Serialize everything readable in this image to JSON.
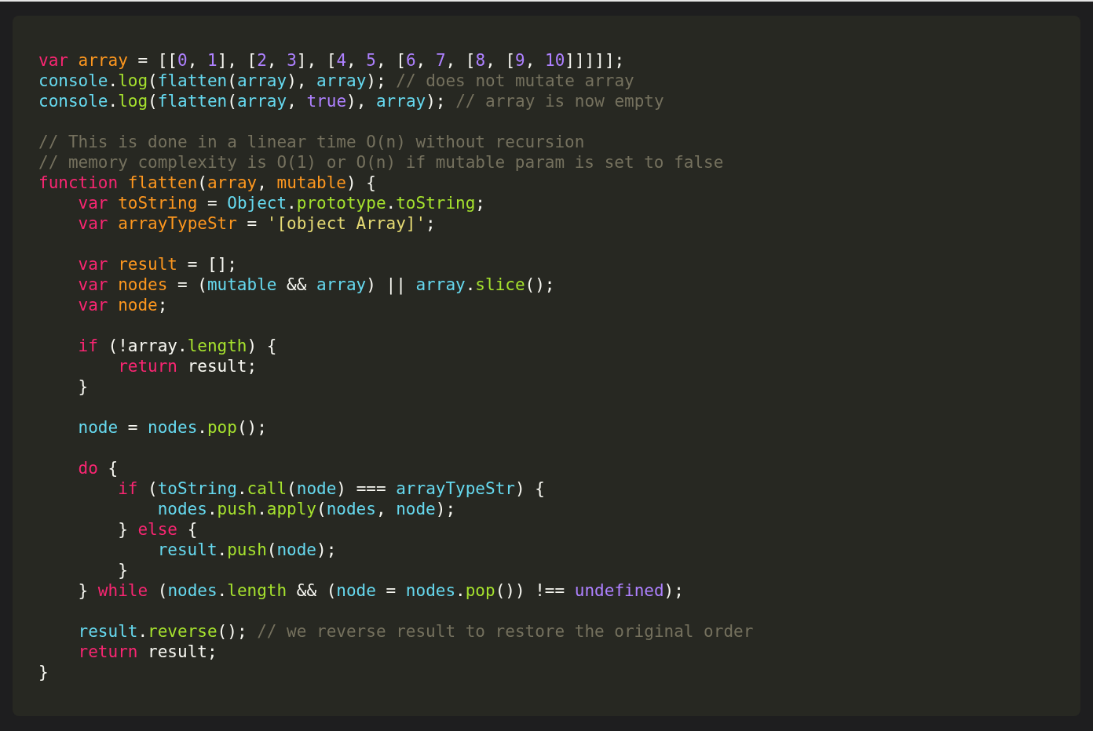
{
  "code": {
    "lines": [
      {
        "kind": "code",
        "tokens": [
          {
            "kind": "kw",
            "text": "var "
          },
          {
            "kind": "var",
            "text": "array"
          },
          {
            "kind": "txt",
            "text": " = [["
          },
          {
            "kind": "num",
            "text": "0"
          },
          {
            "kind": "txt",
            "text": ", "
          },
          {
            "kind": "num",
            "text": "1"
          },
          {
            "kind": "txt",
            "text": "], ["
          },
          {
            "kind": "num",
            "text": "2"
          },
          {
            "kind": "txt",
            "text": ", "
          },
          {
            "kind": "num",
            "text": "3"
          },
          {
            "kind": "txt",
            "text": "], ["
          },
          {
            "kind": "num",
            "text": "4"
          },
          {
            "kind": "txt",
            "text": ", "
          },
          {
            "kind": "num",
            "text": "5"
          },
          {
            "kind": "txt",
            "text": ", ["
          },
          {
            "kind": "num",
            "text": "6"
          },
          {
            "kind": "txt",
            "text": ", "
          },
          {
            "kind": "num",
            "text": "7"
          },
          {
            "kind": "txt",
            "text": ", ["
          },
          {
            "kind": "num",
            "text": "8"
          },
          {
            "kind": "txt",
            "text": ", ["
          },
          {
            "kind": "num",
            "text": "9"
          },
          {
            "kind": "txt",
            "text": ", "
          },
          {
            "kind": "num",
            "text": "10"
          },
          {
            "kind": "txt",
            "text": "]]]]];"
          }
        ]
      },
      {
        "kind": "code",
        "tokens": [
          {
            "kind": "obj",
            "text": "console"
          },
          {
            "kind": "txt",
            "text": "."
          },
          {
            "kind": "fn",
            "text": "log"
          },
          {
            "kind": "txt",
            "text": "("
          },
          {
            "kind": "obj",
            "text": "flatten"
          },
          {
            "kind": "txt",
            "text": "("
          },
          {
            "kind": "obj",
            "text": "array"
          },
          {
            "kind": "txt",
            "text": "), "
          },
          {
            "kind": "obj",
            "text": "array"
          },
          {
            "kind": "txt",
            "text": "); "
          },
          {
            "kind": "com",
            "text": "// does not mutate array"
          }
        ]
      },
      {
        "kind": "code",
        "tokens": [
          {
            "kind": "obj",
            "text": "console"
          },
          {
            "kind": "txt",
            "text": "."
          },
          {
            "kind": "fn",
            "text": "log"
          },
          {
            "kind": "txt",
            "text": "("
          },
          {
            "kind": "obj",
            "text": "flatten"
          },
          {
            "kind": "txt",
            "text": "("
          },
          {
            "kind": "obj",
            "text": "array"
          },
          {
            "kind": "txt",
            "text": ", "
          },
          {
            "kind": "num",
            "text": "true"
          },
          {
            "kind": "txt",
            "text": "), "
          },
          {
            "kind": "obj",
            "text": "array"
          },
          {
            "kind": "txt",
            "text": "); "
          },
          {
            "kind": "com",
            "text": "// array is now empty"
          }
        ]
      },
      {
        "kind": "blank"
      },
      {
        "kind": "code",
        "tokens": [
          {
            "kind": "com",
            "text": "// This is done in a linear time O(n) without recursion"
          }
        ]
      },
      {
        "kind": "code",
        "tokens": [
          {
            "kind": "com",
            "text": "// memory complexity is O(1) or O(n) if mutable param is set to false"
          }
        ]
      },
      {
        "kind": "code",
        "tokens": [
          {
            "kind": "kw",
            "text": "function "
          },
          {
            "kind": "var",
            "text": "flatten"
          },
          {
            "kind": "txt",
            "text": "("
          },
          {
            "kind": "var",
            "text": "array"
          },
          {
            "kind": "txt",
            "text": ", "
          },
          {
            "kind": "var",
            "text": "mutable"
          },
          {
            "kind": "txt",
            "text": ") {"
          }
        ],
        "children": [
          {
            "kind": "code",
            "tokens": [
              {
                "kind": "kw",
                "text": "var "
              },
              {
                "kind": "var",
                "text": "toString"
              },
              {
                "kind": "txt",
                "text": " = "
              },
              {
                "kind": "obj",
                "text": "Object"
              },
              {
                "kind": "txt",
                "text": "."
              },
              {
                "kind": "fn",
                "text": "prototype"
              },
              {
                "kind": "txt",
                "text": "."
              },
              {
                "kind": "fn",
                "text": "toString"
              },
              {
                "kind": "txt",
                "text": ";"
              }
            ]
          },
          {
            "kind": "code",
            "tokens": [
              {
                "kind": "kw",
                "text": "var "
              },
              {
                "kind": "var",
                "text": "arrayTypeStr"
              },
              {
                "kind": "txt",
                "text": " = "
              },
              {
                "kind": "str",
                "text": "'[object Array]'"
              },
              {
                "kind": "txt",
                "text": ";"
              }
            ]
          },
          {
            "kind": "blank"
          },
          {
            "kind": "code",
            "tokens": [
              {
                "kind": "kw",
                "text": "var "
              },
              {
                "kind": "var",
                "text": "result"
              },
              {
                "kind": "txt",
                "text": " = [];"
              }
            ]
          },
          {
            "kind": "code",
            "tokens": [
              {
                "kind": "kw",
                "text": "var "
              },
              {
                "kind": "var",
                "text": "nodes"
              },
              {
                "kind": "txt",
                "text": " = ("
              },
              {
                "kind": "obj",
                "text": "mutable"
              },
              {
                "kind": "txt",
                "text": " && "
              },
              {
                "kind": "obj",
                "text": "array"
              },
              {
                "kind": "txt",
                "text": ") || "
              },
              {
                "kind": "obj",
                "text": "array"
              },
              {
                "kind": "txt",
                "text": "."
              },
              {
                "kind": "fn",
                "text": "slice"
              },
              {
                "kind": "txt",
                "text": "();"
              }
            ]
          },
          {
            "kind": "code",
            "tokens": [
              {
                "kind": "kw",
                "text": "var "
              },
              {
                "kind": "var",
                "text": "node"
              },
              {
                "kind": "txt",
                "text": ";"
              }
            ]
          },
          {
            "kind": "blank"
          },
          {
            "kind": "code",
            "tokens": [
              {
                "kind": "kw",
                "text": "if"
              },
              {
                "kind": "txt",
                "text": " (!array."
              },
              {
                "kind": "fn",
                "text": "length"
              },
              {
                "kind": "txt",
                "text": ") {"
              }
            ],
            "children": [
              {
                "kind": "code",
                "tokens": [
                  {
                    "kind": "kw",
                    "text": "return"
                  },
                  {
                    "kind": "txt",
                    "text": " result;"
                  }
                ]
              }
            ]
          },
          {
            "kind": "code",
            "tokens": [
              {
                "kind": "txt",
                "text": "}"
              }
            ]
          },
          {
            "kind": "blank"
          },
          {
            "kind": "code",
            "tokens": [
              {
                "kind": "obj",
                "text": "node"
              },
              {
                "kind": "txt",
                "text": " = "
              },
              {
                "kind": "obj",
                "text": "nodes"
              },
              {
                "kind": "txt",
                "text": "."
              },
              {
                "kind": "fn",
                "text": "pop"
              },
              {
                "kind": "txt",
                "text": "();"
              }
            ]
          },
          {
            "kind": "blank"
          },
          {
            "kind": "code",
            "tokens": [
              {
                "kind": "kw",
                "text": "do"
              },
              {
                "kind": "txt",
                "text": " {"
              }
            ],
            "children": [
              {
                "kind": "code",
                "tokens": [
                  {
                    "kind": "kw",
                    "text": "if"
                  },
                  {
                    "kind": "txt",
                    "text": " ("
                  },
                  {
                    "kind": "obj",
                    "text": "toString"
                  },
                  {
                    "kind": "txt",
                    "text": "."
                  },
                  {
                    "kind": "fn",
                    "text": "call"
                  },
                  {
                    "kind": "txt",
                    "text": "("
                  },
                  {
                    "kind": "obj",
                    "text": "node"
                  },
                  {
                    "kind": "txt",
                    "text": ") === "
                  },
                  {
                    "kind": "obj",
                    "text": "arrayTypeStr"
                  },
                  {
                    "kind": "txt",
                    "text": ") {"
                  }
                ],
                "children": [
                  {
                    "kind": "code",
                    "tokens": [
                      {
                        "kind": "obj",
                        "text": "nodes"
                      },
                      {
                        "kind": "txt",
                        "text": "."
                      },
                      {
                        "kind": "fn",
                        "text": "push"
                      },
                      {
                        "kind": "txt",
                        "text": "."
                      },
                      {
                        "kind": "fn",
                        "text": "apply"
                      },
                      {
                        "kind": "txt",
                        "text": "("
                      },
                      {
                        "kind": "obj",
                        "text": "nodes"
                      },
                      {
                        "kind": "txt",
                        "text": ", "
                      },
                      {
                        "kind": "obj",
                        "text": "node"
                      },
                      {
                        "kind": "txt",
                        "text": ");"
                      }
                    ]
                  }
                ]
              },
              {
                "kind": "code",
                "tokens": [
                  {
                    "kind": "txt",
                    "text": "} "
                  },
                  {
                    "kind": "kw",
                    "text": "else"
                  },
                  {
                    "kind": "txt",
                    "text": " {"
                  }
                ],
                "children": [
                  {
                    "kind": "code",
                    "tokens": [
                      {
                        "kind": "obj",
                        "text": "result"
                      },
                      {
                        "kind": "txt",
                        "text": "."
                      },
                      {
                        "kind": "fn",
                        "text": "push"
                      },
                      {
                        "kind": "txt",
                        "text": "("
                      },
                      {
                        "kind": "obj",
                        "text": "node"
                      },
                      {
                        "kind": "txt",
                        "text": ");"
                      }
                    ]
                  }
                ]
              },
              {
                "kind": "code",
                "tokens": [
                  {
                    "kind": "txt",
                    "text": "}"
                  }
                ]
              }
            ]
          },
          {
            "kind": "code",
            "tokens": [
              {
                "kind": "txt",
                "text": "} "
              },
              {
                "kind": "kw",
                "text": "while"
              },
              {
                "kind": "txt",
                "text": " ("
              },
              {
                "kind": "obj",
                "text": "nodes"
              },
              {
                "kind": "txt",
                "text": "."
              },
              {
                "kind": "fn",
                "text": "length"
              },
              {
                "kind": "txt",
                "text": " && ("
              },
              {
                "kind": "obj",
                "text": "node"
              },
              {
                "kind": "txt",
                "text": " = "
              },
              {
                "kind": "obj",
                "text": "nodes"
              },
              {
                "kind": "txt",
                "text": "."
              },
              {
                "kind": "fn",
                "text": "pop"
              },
              {
                "kind": "txt",
                "text": "()) !== "
              },
              {
                "kind": "num",
                "text": "undefined"
              },
              {
                "kind": "txt",
                "text": ");"
              }
            ]
          },
          {
            "kind": "blank"
          },
          {
            "kind": "code",
            "tokens": [
              {
                "kind": "obj",
                "text": "result"
              },
              {
                "kind": "txt",
                "text": "."
              },
              {
                "kind": "fn",
                "text": "reverse"
              },
              {
                "kind": "txt",
                "text": "(); "
              },
              {
                "kind": "com",
                "text": "// we reverse result to restore the original order"
              }
            ]
          },
          {
            "kind": "code",
            "tokens": [
              {
                "kind": "kw",
                "text": "return"
              },
              {
                "kind": "txt",
                "text": " result;"
              }
            ]
          }
        ]
      },
      {
        "kind": "code",
        "tokens": [
          {
            "kind": "txt",
            "text": "}"
          }
        ]
      }
    ]
  }
}
